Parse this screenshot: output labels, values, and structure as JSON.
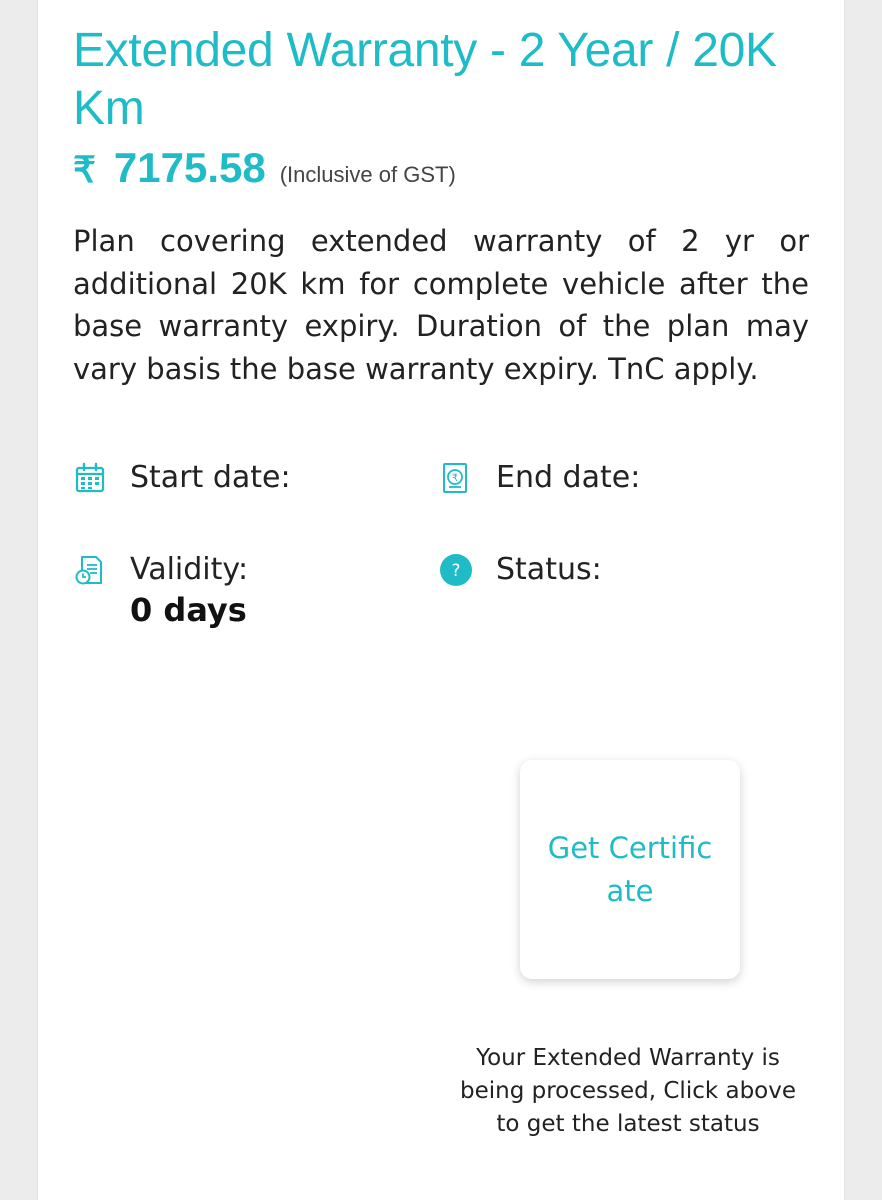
{
  "plan": {
    "title": "Extended Warranty - 2 Year / 20K Km",
    "currency_symbol": "₹",
    "price": "7175.58",
    "tax_note": "(Inclusive of GST)",
    "description": "Plan covering extended warranty of 2 yr or additional 20K km for complete vehicle after the base warranty expiry. Duration of the plan may vary basis the base warranty expiry. TnC apply."
  },
  "details": {
    "start_date": {
      "label": "Start date:",
      "value": "",
      "icon": "calendar-icon"
    },
    "end_date": {
      "label": "End date:",
      "value": "",
      "icon": "receipt-rupee-icon"
    },
    "validity": {
      "label": "Validity:",
      "value": "0 days",
      "icon": "document-clock-icon"
    },
    "status": {
      "label": "Status:",
      "value": "",
      "icon": "question-circle-icon",
      "icon_glyph": "?"
    }
  },
  "actions": {
    "get_certificate_label": "Get Certificate"
  },
  "processing_message": "Your Extended Warranty is being processed, Click above to get the latest status",
  "colors": {
    "accent": "#1fbcc7",
    "text": "#222222",
    "background": "#ececec",
    "card": "#ffffff"
  }
}
